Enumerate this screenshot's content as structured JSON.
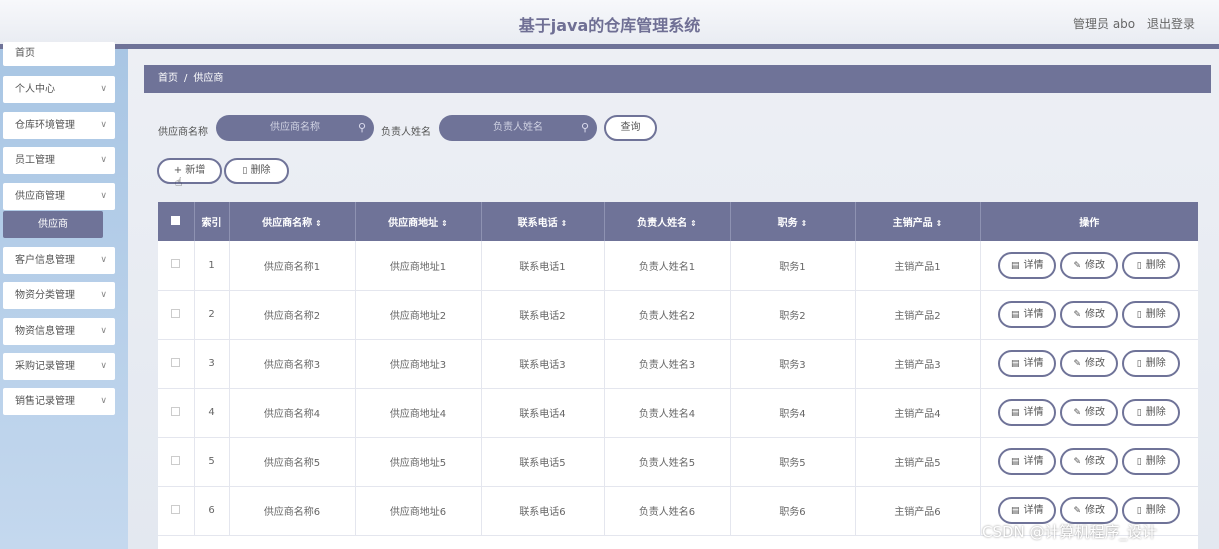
{
  "header": {
    "title": "基于java的仓库管理系统",
    "admin": "管理员 abo",
    "logout": "退出登录"
  },
  "sidebar": {
    "items": [
      {
        "label": "首页",
        "chevron": false
      },
      {
        "label": "个人中心",
        "chevron": true
      },
      {
        "label": "仓库环境管理",
        "chevron": true
      },
      {
        "label": "员工管理",
        "chevron": true
      },
      {
        "label": "供应商管理",
        "chevron": true
      },
      {
        "label": "供应商",
        "chevron": false,
        "sub": true
      },
      {
        "label": "客户信息管理",
        "chevron": true
      },
      {
        "label": "物资分类管理",
        "chevron": true
      },
      {
        "label": "物资信息管理",
        "chevron": true
      },
      {
        "label": "采购记录管理",
        "chevron": true
      },
      {
        "label": "销售记录管理",
        "chevron": true
      }
    ]
  },
  "breadcrumb": {
    "home": "首页",
    "separator": "/",
    "current": "供应商"
  },
  "search": {
    "name_label": "供应商名称",
    "name_placeholder": "供应商名称",
    "person_label": "负责人姓名",
    "person_placeholder": "负责人姓名",
    "query_button": "查询"
  },
  "toolbar": {
    "add": "新增",
    "delete": "删除",
    "add_icon": "+",
    "delete_icon": "🗑"
  },
  "table": {
    "headers": [
      "索引",
      "供应商名称",
      "供应商地址",
      "联系电话",
      "负责人姓名",
      "职务",
      "主销产品",
      "操作"
    ],
    "rows": [
      {
        "idx": "1",
        "name": "供应商名称1",
        "addr": "供应商地址1",
        "phone": "联系电话1",
        "person": "负责人姓名1",
        "duty": "职务1",
        "product": "主销产品1"
      },
      {
        "idx": "2",
        "name": "供应商名称2",
        "addr": "供应商地址2",
        "phone": "联系电话2",
        "person": "负责人姓名2",
        "duty": "职务2",
        "product": "主销产品2"
      },
      {
        "idx": "3",
        "name": "供应商名称3",
        "addr": "供应商地址3",
        "phone": "联系电话3",
        "person": "负责人姓名3",
        "duty": "职务3",
        "product": "主销产品3"
      },
      {
        "idx": "4",
        "name": "供应商名称4",
        "addr": "供应商地址4",
        "phone": "联系电话4",
        "person": "负责人姓名4",
        "duty": "职务4",
        "product": "主销产品4"
      },
      {
        "idx": "5",
        "name": "供应商名称5",
        "addr": "供应商地址5",
        "phone": "联系电话5",
        "person": "负责人姓名5",
        "duty": "职务5",
        "product": "主销产品5"
      },
      {
        "idx": "6",
        "name": "供应商名称6",
        "addr": "供应商地址6",
        "phone": "联系电话6",
        "person": "负责人姓名6",
        "duty": "职务6",
        "product": "主销产品6"
      }
    ],
    "actions": {
      "detail": "详情",
      "edit": "修改",
      "delete": "删除"
    }
  },
  "watermark": "CSDN @计算机程序_设计"
}
